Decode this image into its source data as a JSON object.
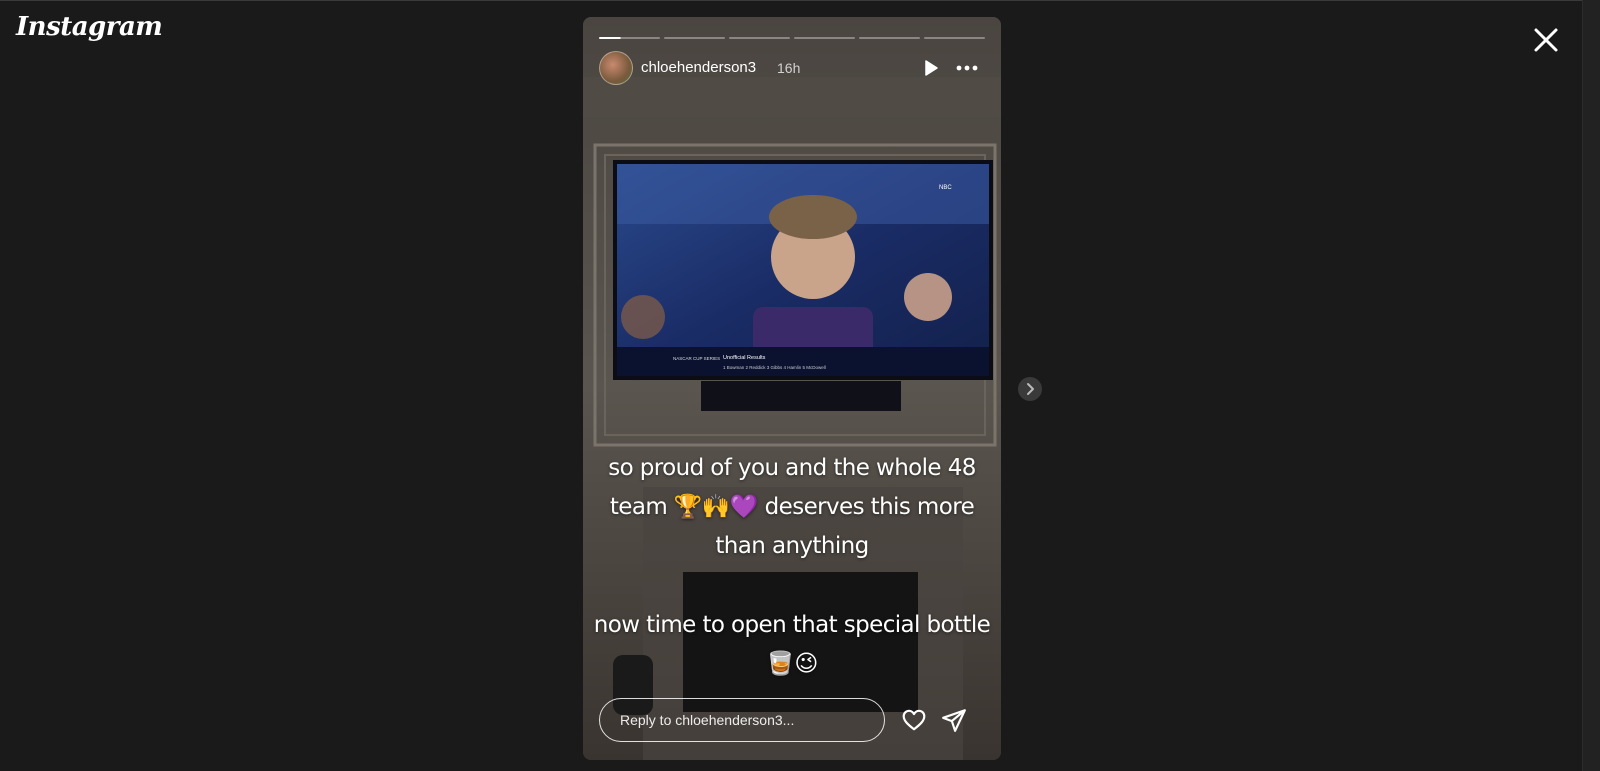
{
  "app": {
    "logo_text": "Instagram"
  },
  "story": {
    "username": "chloehenderson3",
    "time_ago": "16h",
    "progress": {
      "segments": 6,
      "current": 1,
      "current_fill": 0.35
    },
    "caption_lines": [
      "so proud of you and the whole 48",
      "team 🏆🙌💜 deserves this more",
      "than anything",
      "",
      "now time to open that special bottle",
      "🥃😉"
    ],
    "tv": {
      "series": "NASCAR CUP SERIES",
      "banner_title": "Unofficial Results",
      "results": "1 Bowman  2 Reddick  3 Gibbs  4 Hamlin  5 McDowell",
      "network": "NBC"
    },
    "reply": {
      "placeholder": "Reply to chloehenderson3..."
    }
  },
  "icons": {
    "close": "close-icon",
    "play": "play-icon",
    "more": "more-icon",
    "heart": "heart-icon",
    "send": "send-icon",
    "next": "chevron-right-icon"
  },
  "colors": {
    "background": "#1a1a1a",
    "text": "#ffffff"
  }
}
